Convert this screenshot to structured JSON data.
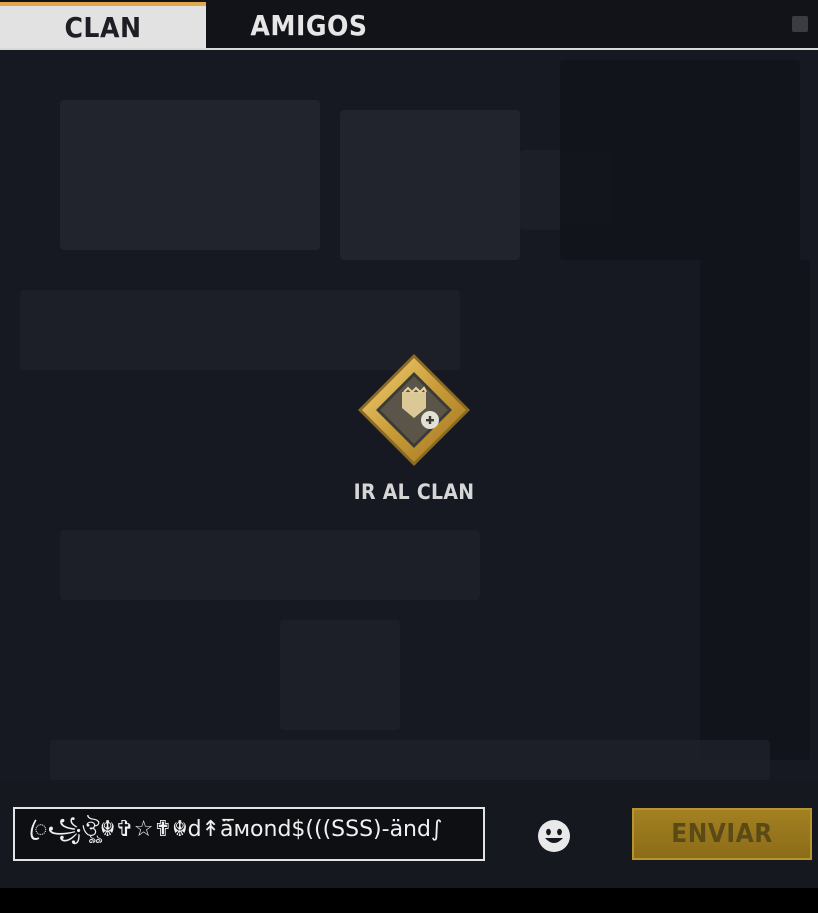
{
  "tabs": [
    {
      "label": "CLAN",
      "active": true
    },
    {
      "label": "AMIGOS",
      "active": false
    }
  ],
  "main": {
    "go_clan_label": "IR AL CLAN",
    "go_clan_icon": "clan-emblem-icon"
  },
  "chat": {
    "input_value": "ꦿ꧁ঔৣ☬✞☆✟☬d↟ä̅мond$(((SSS)-änd∫",
    "emoji_icon": "smiley-icon",
    "send_label": "ENVIAR"
  },
  "colors": {
    "accent_gold": "#c9a13a",
    "tab_active_bg": "#e2e2e2",
    "tab_active_top": "#e1a94a",
    "background": "#161922",
    "send_button": "#9a7a1e"
  }
}
